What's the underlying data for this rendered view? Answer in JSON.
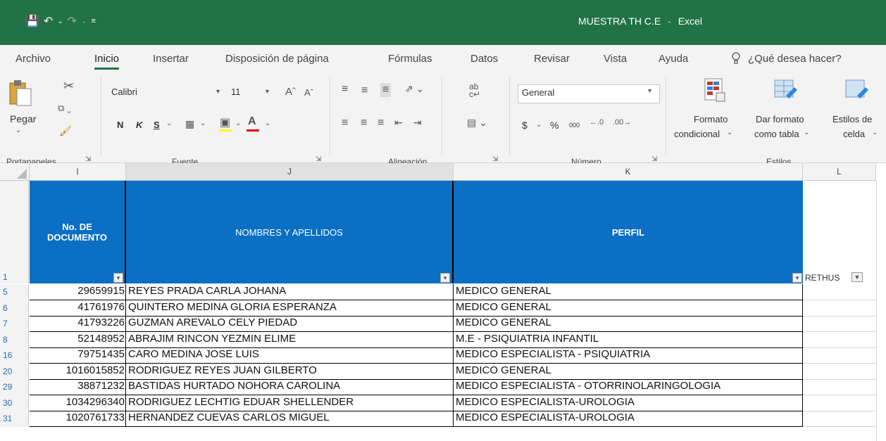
{
  "title_bar": {
    "title": "MUESTRA TH C.E",
    "separator": "-",
    "app": "Excel"
  },
  "tabs": [
    "Archivo",
    "Inicio",
    "Insertar",
    "Disposición de página",
    "Fórmulas",
    "Datos",
    "Revisar",
    "Vista",
    "Ayuda"
  ],
  "active_tab": "Inicio",
  "tell_me": "¿Qué desea hacer?",
  "ribbon": {
    "clipboard": {
      "paste_label": "Pegar",
      "group": "Portapapeles"
    },
    "font": {
      "name": "Calibri",
      "size": "11",
      "bold": "N",
      "italic": "K",
      "underline": "S",
      "group": "Fuente"
    },
    "alignment": {
      "group": "Alineación"
    },
    "number": {
      "format": "General",
      "currency": "$",
      "percent": "%",
      "thousands": "000",
      "group": "Número"
    },
    "styles": {
      "conditional_line1": "Formato",
      "conditional_line2": "condicional",
      "table_line1": "Dar formato",
      "table_line2": "como tabla",
      "cell_line1": "Estilos de",
      "cell_line2": "celda",
      "group": "Estilos"
    }
  },
  "columns": [
    "I",
    "J",
    "K",
    "L"
  ],
  "header_row_number": "1",
  "headers": {
    "doc_line1": "No. DE",
    "doc_line2": "DOCUMENTO",
    "names": "NOMBRES Y APELLIDOS",
    "profile": "PERFIL",
    "rethus": "RETHUS"
  },
  "rows": [
    {
      "row": "5",
      "doc": "29659915",
      "name": "REYES PRADA CARLA JOHANA",
      "profile": "MEDICO GENERAL"
    },
    {
      "row": "6",
      "doc": "41761976",
      "name": "QUINTERO MEDINA GLORIA ESPERANZA",
      "profile": "MEDICO GENERAL"
    },
    {
      "row": "7",
      "doc": "41793226",
      "name": "GUZMAN AREVALO CELY PIEDAD",
      "profile": "MEDICO GENERAL"
    },
    {
      "row": "8",
      "doc": "52148952",
      "name": "ABRAJIM RINCON YEZMIN ELIME",
      "profile": "M.E - PSIQUIATRIA INFANTIL"
    },
    {
      "row": "16",
      "doc": "79751435",
      "name": "CARO MEDINA JOSE LUIS",
      "profile": "MEDICO ESPECIALISTA - PSIQUIATRIA"
    },
    {
      "row": "20",
      "doc": "1016015852",
      "name": "RODRIGUEZ REYES JUAN GILBERTO",
      "profile": "MEDICO GENERAL"
    },
    {
      "row": "29",
      "doc": "38871232",
      "name": "BASTIDAS HURTADO NOHORA CAROLINA",
      "profile": "MEDICO ESPECIALISTA - OTORRINOLARINGOLOGIA"
    },
    {
      "row": "30",
      "doc": "1034296340",
      "name": "RODRIGUEZ  LECHTIG EDUAR SHELLENDER",
      "profile": "MEDICO ESPECIALISTA-UROLOGIA"
    },
    {
      "row": "31",
      "doc": "1020761733",
      "name": "HERNANDEZ CUEVAS CARLOS MIGUEL",
      "profile": "MEDICO ESPECIALISTA-UROLOGIA"
    }
  ],
  "colors": {
    "excel_green": "#217346",
    "header_blue": "#0b6fc4"
  }
}
